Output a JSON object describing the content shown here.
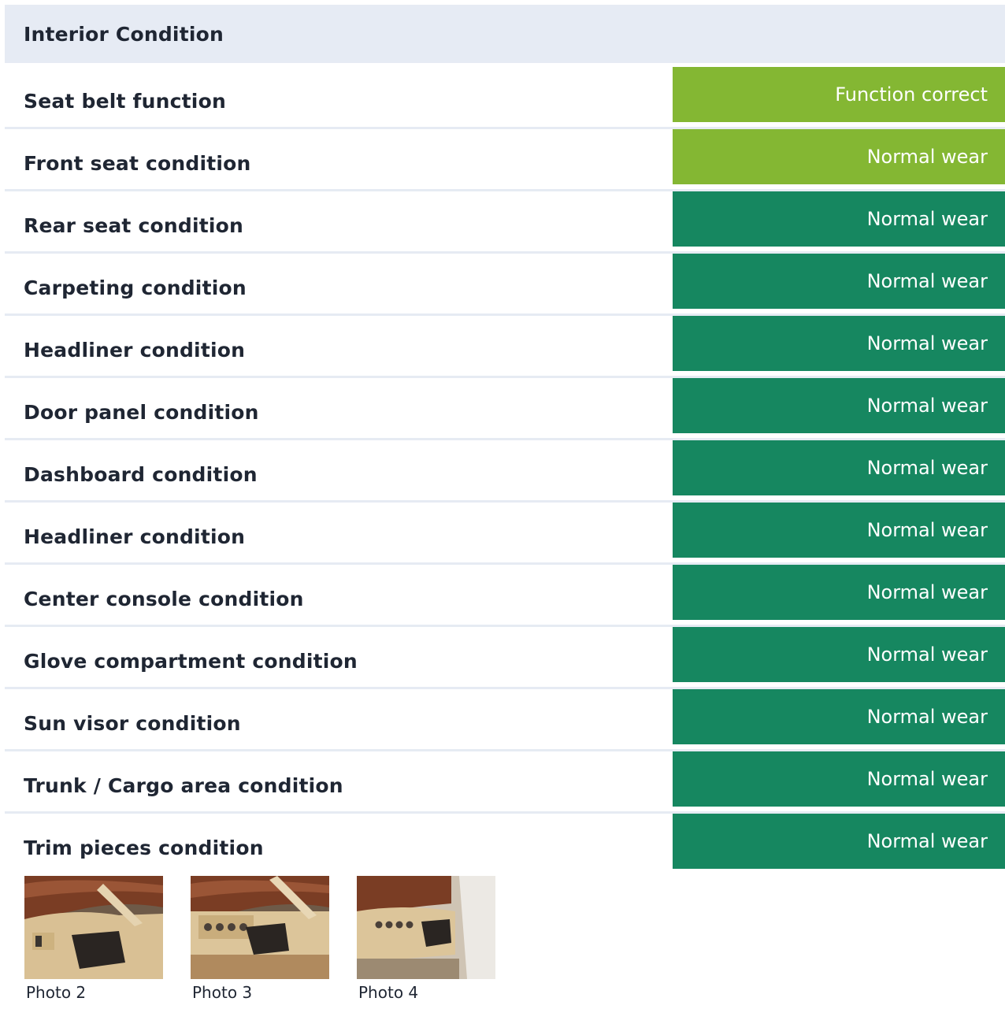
{
  "section": {
    "title": "Interior Condition"
  },
  "colors": {
    "header_bg": "#e6ebf4",
    "status_good_light": "#84b733",
    "status_good_dark": "#168760",
    "divider": "#e6ebf3"
  },
  "rows": [
    {
      "label": "Seat belt function",
      "value": "Function correct",
      "status": "light"
    },
    {
      "label": "Front seat condition",
      "value": "Normal wear",
      "status": "light"
    },
    {
      "label": "Rear seat condition",
      "value": "Normal wear",
      "status": "dark"
    },
    {
      "label": "Carpeting condition",
      "value": "Normal wear",
      "status": "dark"
    },
    {
      "label": "Headliner condition",
      "value": "Normal wear",
      "status": "dark"
    },
    {
      "label": "Door panel condition",
      "value": "Normal wear",
      "status": "dark"
    },
    {
      "label": "Dashboard condition",
      "value": "Normal wear",
      "status": "dark"
    },
    {
      "label": "Headliner condition",
      "value": "Normal wear",
      "status": "dark"
    },
    {
      "label": "Center console condition",
      "value": "Normal wear",
      "status": "dark"
    },
    {
      "label": "Glove compartment condition",
      "value": "Normal wear",
      "status": "dark"
    },
    {
      "label": "Sun visor condition",
      "value": "Normal wear",
      "status": "dark"
    },
    {
      "label": "Trunk / Cargo area condition",
      "value": "Normal wear",
      "status": "dark"
    },
    {
      "label": "Trim pieces condition",
      "value": "Normal wear",
      "status": "dark"
    }
  ],
  "photos": [
    {
      "caption": "Photo 2",
      "variant": 1
    },
    {
      "caption": "Photo 3",
      "variant": 2
    },
    {
      "caption": "Photo 4",
      "variant": 3
    }
  ]
}
